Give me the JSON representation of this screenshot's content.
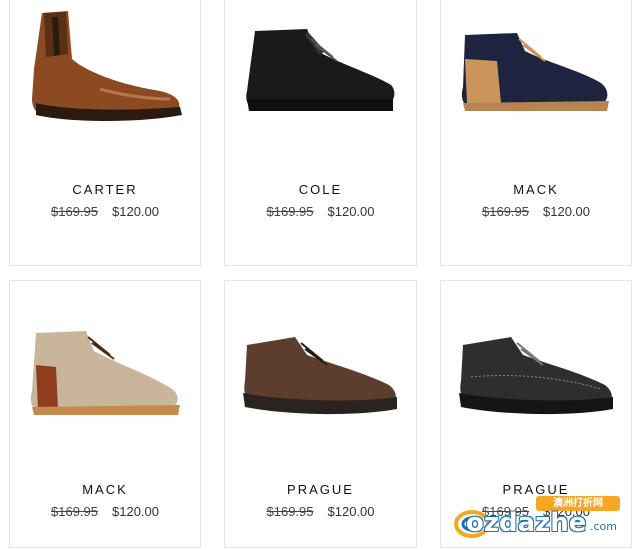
{
  "products": [
    {
      "name": "CARTER",
      "was_price": "$169.95",
      "price": "$120.00",
      "image": "brown-leather-chelsea-boot"
    },
    {
      "name": "COLE",
      "was_price": "$169.95",
      "price": "$120.00",
      "image": "black-leather-chukka-boot"
    },
    {
      "name": "MACK",
      "was_price": "$169.95",
      "price": "$120.00",
      "image": "navy-suede-chukka-boot"
    },
    {
      "name": "MACK",
      "was_price": "$169.95",
      "price": "$120.00",
      "image": "beige-suede-chukka-boot"
    },
    {
      "name": "PRAGUE",
      "was_price": "$169.95",
      "price": "$120.00",
      "image": "brown-nubuck-lace-up-shoe"
    },
    {
      "name": "PRAGUE",
      "was_price": "$169.95",
      "price": "$120.00",
      "image": "black-nubuck-lace-up-shoe"
    }
  ],
  "watermark": {
    "badge": "澳洲打折网",
    "logo": "ozdazhe",
    "suffix": ".com"
  },
  "colors": {
    "card_border": "#e6e6e6",
    "text": "#111111",
    "watermark_blue": "#1b6fb3",
    "watermark_orange": "#f5a623"
  }
}
